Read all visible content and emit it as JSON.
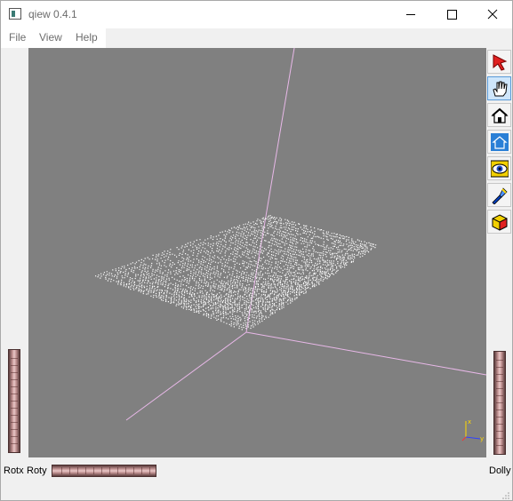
{
  "window": {
    "title": "qiew 0.4.1"
  },
  "menu": {
    "items": [
      "File",
      "View",
      "Help"
    ]
  },
  "toolbar": {
    "tools": [
      {
        "name": "pick-arrow-icon",
        "state": "normal"
      },
      {
        "name": "hand-pan-icon",
        "state": "active"
      },
      {
        "name": "home-icon",
        "state": "normal"
      },
      {
        "name": "set-home-icon",
        "state": "normal"
      },
      {
        "name": "eye-view-all-icon",
        "state": "normal"
      },
      {
        "name": "seek-flashlight-icon",
        "state": "normal"
      },
      {
        "name": "projection-cube-icon",
        "state": "normal"
      }
    ]
  },
  "wheels": {
    "rotx": "Rotx",
    "roty": "Roty",
    "dolly": "Dolly"
  },
  "colors": {
    "viewer_bg": "#808080",
    "axis": "#e8b8e8",
    "points": "#ffffff",
    "wheel": "#c99a9a"
  }
}
